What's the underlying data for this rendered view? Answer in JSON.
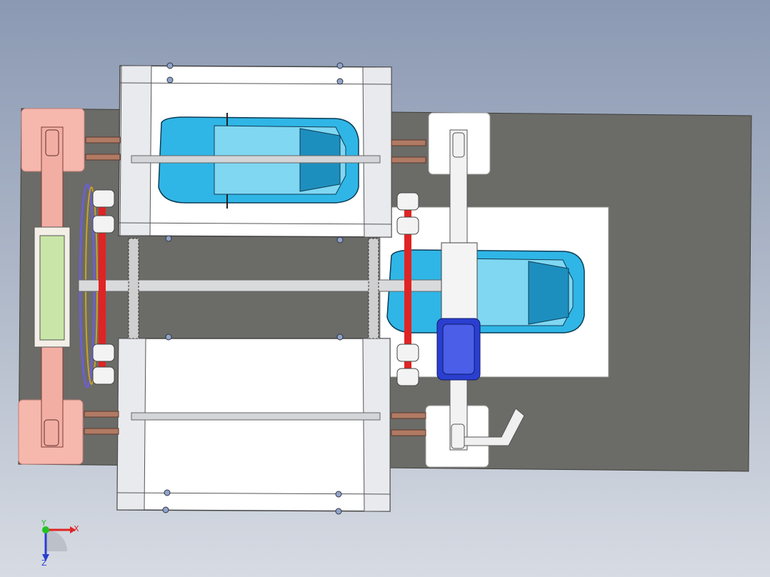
{
  "viewport": {
    "background_top": "#8b99b3",
    "background_bottom": "#d7dbe3"
  },
  "model": {
    "base_plate_color": "#6a6a66",
    "frame_color": "#ffffff",
    "pink_pad_color": "#f6b7ad",
    "car_color": "#2fb6e6",
    "motor_color": "#2a3fd0",
    "sprocket_color": "#e02424",
    "rod_color": "#c7c9cc",
    "bolt_color": "#b07a64"
  },
  "triad": {
    "x_label": "X",
    "y_label": "Y",
    "z_label": "Z",
    "x_color": "#e02424",
    "y_color": "#22c322",
    "z_color": "#2a3fd0"
  }
}
